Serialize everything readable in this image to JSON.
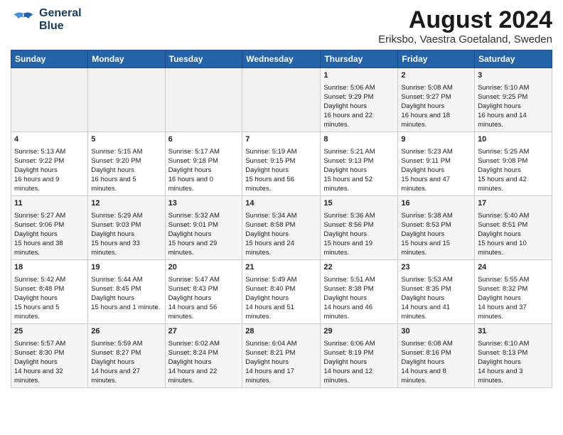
{
  "header": {
    "title": "August 2024",
    "subtitle": "Eriksbo, Vaestra Goetaland, Sweden",
    "logo_line1": "General",
    "logo_line2": "Blue"
  },
  "days_of_week": [
    "Sunday",
    "Monday",
    "Tuesday",
    "Wednesday",
    "Thursday",
    "Friday",
    "Saturday"
  ],
  "weeks": [
    {
      "days": [
        {
          "num": "",
          "empty": true
        },
        {
          "num": "",
          "empty": true
        },
        {
          "num": "",
          "empty": true
        },
        {
          "num": "",
          "empty": true
        },
        {
          "num": "1",
          "sunrise": "5:06 AM",
          "sunset": "9:29 PM",
          "daylight": "16 hours and 22 minutes."
        },
        {
          "num": "2",
          "sunrise": "5:08 AM",
          "sunset": "9:27 PM",
          "daylight": "16 hours and 18 minutes."
        },
        {
          "num": "3",
          "sunrise": "5:10 AM",
          "sunset": "9:25 PM",
          "daylight": "16 hours and 14 minutes."
        }
      ]
    },
    {
      "days": [
        {
          "num": "4",
          "sunrise": "5:13 AM",
          "sunset": "9:22 PM",
          "daylight": "16 hours and 9 minutes."
        },
        {
          "num": "5",
          "sunrise": "5:15 AM",
          "sunset": "9:20 PM",
          "daylight": "16 hours and 5 minutes."
        },
        {
          "num": "6",
          "sunrise": "5:17 AM",
          "sunset": "9:18 PM",
          "daylight": "16 hours and 0 minutes."
        },
        {
          "num": "7",
          "sunrise": "5:19 AM",
          "sunset": "9:15 PM",
          "daylight": "15 hours and 56 minutes."
        },
        {
          "num": "8",
          "sunrise": "5:21 AM",
          "sunset": "9:13 PM",
          "daylight": "15 hours and 52 minutes."
        },
        {
          "num": "9",
          "sunrise": "5:23 AM",
          "sunset": "9:11 PM",
          "daylight": "15 hours and 47 minutes."
        },
        {
          "num": "10",
          "sunrise": "5:25 AM",
          "sunset": "9:08 PM",
          "daylight": "15 hours and 42 minutes."
        }
      ]
    },
    {
      "days": [
        {
          "num": "11",
          "sunrise": "5:27 AM",
          "sunset": "9:06 PM",
          "daylight": "15 hours and 38 minutes."
        },
        {
          "num": "12",
          "sunrise": "5:29 AM",
          "sunset": "9:03 PM",
          "daylight": "15 hours and 33 minutes."
        },
        {
          "num": "13",
          "sunrise": "5:32 AM",
          "sunset": "9:01 PM",
          "daylight": "15 hours and 29 minutes."
        },
        {
          "num": "14",
          "sunrise": "5:34 AM",
          "sunset": "8:58 PM",
          "daylight": "15 hours and 24 minutes."
        },
        {
          "num": "15",
          "sunrise": "5:36 AM",
          "sunset": "8:56 PM",
          "daylight": "15 hours and 19 minutes."
        },
        {
          "num": "16",
          "sunrise": "5:38 AM",
          "sunset": "8:53 PM",
          "daylight": "15 hours and 15 minutes."
        },
        {
          "num": "17",
          "sunrise": "5:40 AM",
          "sunset": "8:51 PM",
          "daylight": "15 hours and 10 minutes."
        }
      ]
    },
    {
      "days": [
        {
          "num": "18",
          "sunrise": "5:42 AM",
          "sunset": "8:48 PM",
          "daylight": "15 hours and 5 minutes."
        },
        {
          "num": "19",
          "sunrise": "5:44 AM",
          "sunset": "8:45 PM",
          "daylight": "15 hours and 1 minute."
        },
        {
          "num": "20",
          "sunrise": "5:47 AM",
          "sunset": "8:43 PM",
          "daylight": "14 hours and 56 minutes."
        },
        {
          "num": "21",
          "sunrise": "5:49 AM",
          "sunset": "8:40 PM",
          "daylight": "14 hours and 51 minutes."
        },
        {
          "num": "22",
          "sunrise": "5:51 AM",
          "sunset": "8:38 PM",
          "daylight": "14 hours and 46 minutes."
        },
        {
          "num": "23",
          "sunrise": "5:53 AM",
          "sunset": "8:35 PM",
          "daylight": "14 hours and 41 minutes."
        },
        {
          "num": "24",
          "sunrise": "5:55 AM",
          "sunset": "8:32 PM",
          "daylight": "14 hours and 37 minutes."
        }
      ]
    },
    {
      "days": [
        {
          "num": "25",
          "sunrise": "5:57 AM",
          "sunset": "8:30 PM",
          "daylight": "14 hours and 32 minutes."
        },
        {
          "num": "26",
          "sunrise": "5:59 AM",
          "sunset": "8:27 PM",
          "daylight": "14 hours and 27 minutes."
        },
        {
          "num": "27",
          "sunrise": "6:02 AM",
          "sunset": "8:24 PM",
          "daylight": "14 hours and 22 minutes."
        },
        {
          "num": "28",
          "sunrise": "6:04 AM",
          "sunset": "8:21 PM",
          "daylight": "14 hours and 17 minutes."
        },
        {
          "num": "29",
          "sunrise": "6:06 AM",
          "sunset": "8:19 PM",
          "daylight": "14 hours and 12 minutes."
        },
        {
          "num": "30",
          "sunrise": "6:08 AM",
          "sunset": "8:16 PM",
          "daylight": "14 hours and 8 minutes."
        },
        {
          "num": "31",
          "sunrise": "6:10 AM",
          "sunset": "8:13 PM",
          "daylight": "14 hours and 3 minutes."
        }
      ]
    }
  ]
}
